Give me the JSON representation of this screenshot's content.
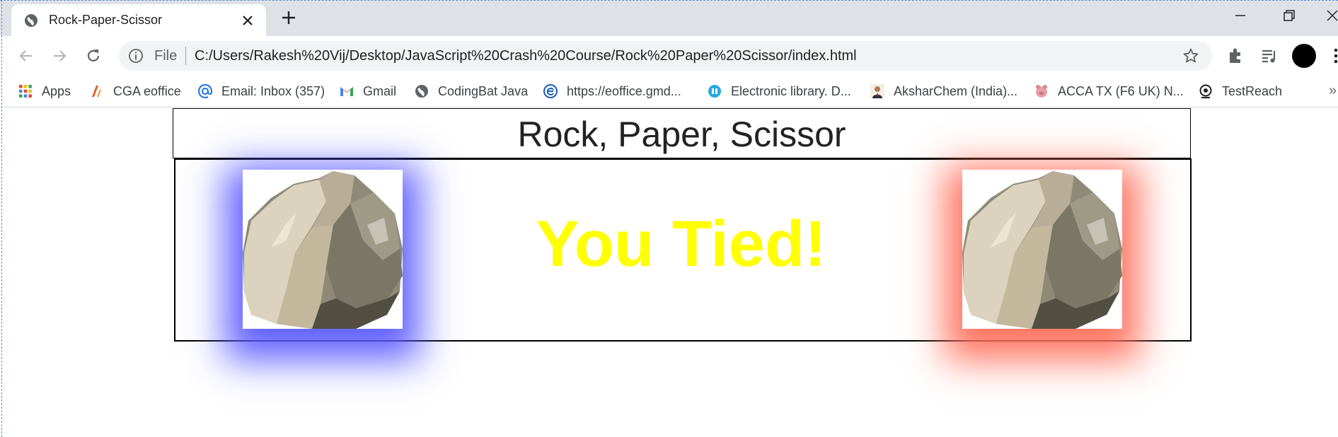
{
  "browser": {
    "tab": {
      "title": "Rock-Paper-Scissor"
    },
    "omnibox": {
      "scheme_label": "File",
      "url": "C:/Users/Rakesh%20Vij/Desktop/JavaScript%20Crash%20Course/Rock%20Paper%20Scissor/index.html"
    },
    "bookmarks": [
      {
        "label": "Apps",
        "icon": "apps-grid-icon"
      },
      {
        "label": "CGA eoffice",
        "icon": "cga-icon"
      },
      {
        "label": "Email: Inbox (357)",
        "icon": "at-sign-icon"
      },
      {
        "label": "Gmail",
        "icon": "gmail-icon"
      },
      {
        "label": "CodingBat Java",
        "icon": "globe-icon"
      },
      {
        "label": "https://eoffice.gmd...",
        "icon": "eoffice-icon"
      },
      {
        "label": "Electronic library. D...",
        "icon": "library-icon"
      },
      {
        "label": "AksharChem (India)...",
        "icon": "person-photo-icon"
      },
      {
        "label": "ACCA TX (F6 UK) N...",
        "icon": "pig-icon"
      },
      {
        "label": "TestReach",
        "icon": "testreach-icon"
      }
    ],
    "bookmarks_more": "»"
  },
  "game": {
    "title": "Rock, Paper, Scissor",
    "result": "You Tied!",
    "player_choice": "rock",
    "computer_choice": "rock",
    "colors": {
      "result": "#ffff00",
      "player_glow": "#5a5aff",
      "computer_glow": "#ff6e5a"
    }
  }
}
